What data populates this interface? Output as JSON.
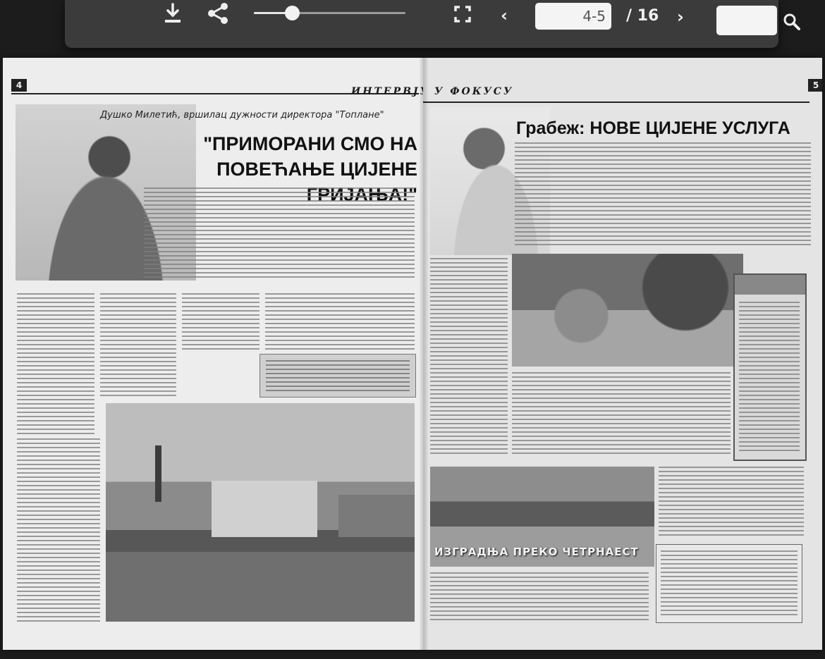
{
  "toolbar": {
    "download_icon": "download-icon",
    "share_icon": "share-icon",
    "zoom_level_fraction": 0.25,
    "fullscreen_icon": "fullscreen-icon",
    "prev_icon": "chevron-left-icon",
    "page_input_value": "4-5",
    "page_total": "/ 16",
    "next_icon": "chevron-right-icon",
    "search_input_value": "",
    "search_icon": "search-icon"
  },
  "spread": {
    "left_page": {
      "page_number": "4",
      "section_label": "ИНТЕРВЈУ",
      "byline": "Душко Милетић, вршилац дужности директора \"Топлане\"",
      "headline": "\"ПРИМОРАНИ СМО НА ПОВЕЋАЊЕ ЦИЈЕНЕ ГРИЈАЊА!\""
    },
    "right_page": {
      "page_number": "5",
      "section_label": "У ФОКУСУ",
      "headline": "Грабеж: НОВЕ ЦИЈЕНЕ УСЛУГА",
      "photo_caption": "ИЗГРАДЊА ПРЕКО ЧЕТРНАЕСТ"
    }
  }
}
